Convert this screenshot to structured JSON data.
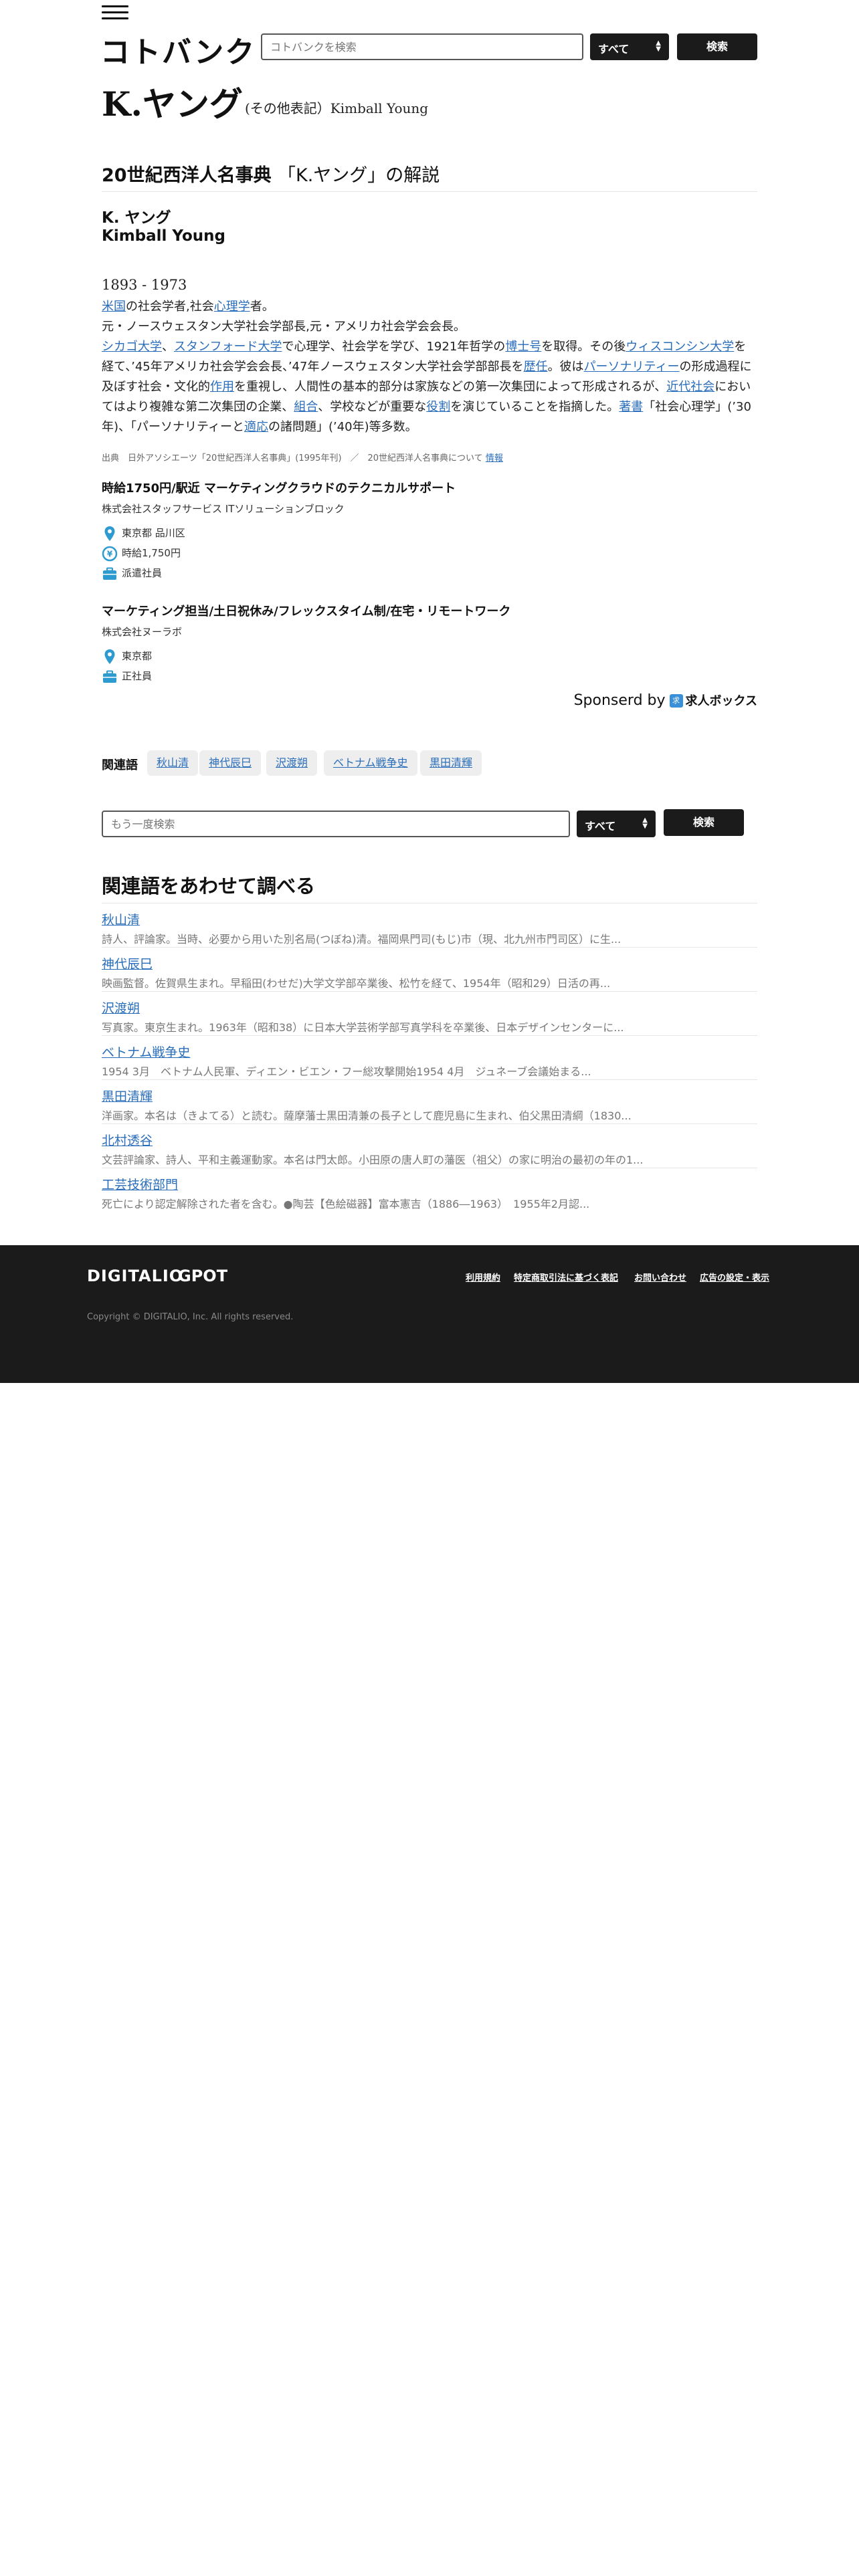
{
  "header": {
    "logo": "コトバンク",
    "search_placeholder": "コトバンクを検索",
    "select_value": "すべて",
    "search_button": "検索"
  },
  "page": {
    "title": "K.ヤング",
    "title_alt": "(その他表記）Kimball Young"
  },
  "dictionary": {
    "name": "20世紀西洋人名事典",
    "heading_suffix": "「K.ヤング」の解説",
    "entry_name_ja": "K. ヤング",
    "entry_name_en": "Kimball Young",
    "years": "1893 - 1973",
    "line1": {
      "a": "米国",
      "b": "の社会学者,社会",
      "c": "心理学",
      "d": "者。"
    },
    "line2": "元・ノースウェスタン大学社会学部長,元・アメリカ社会学会会長。",
    "para": {
      "p1": "シカゴ大学",
      "p2": "、",
      "p3": "スタンフォード大学",
      "p4": "で心理学、社会学を学び、1921年哲学の",
      "p5": "博士号",
      "p6": "を取得。その後",
      "p7": "ウィスコンシン大学",
      "p8": "を経て、’45年アメリカ社会学会会長、’47年ノースウェスタン大学社会学部部長を",
      "p9": "歴任",
      "p10": "。彼は",
      "p11": "パーソナリティー",
      "p12": "の形成過程に及ぼす社会・文化的",
      "p13": "作用",
      "p14": "を重視し、人間性の基本的部分は家族などの第一次集団によって形成されるが、",
      "p15": "近代社会",
      "p16": "においてはより複雑な第二次集団の企業、",
      "p17": "組合",
      "p18": "、学校などが重要な",
      "p19": "役割",
      "p20": "を演じていることを指摘した。",
      "p21": "著書",
      "p22": "「社会心理学」(’30年)、「パーソナリティーと",
      "p23": "適応",
      "p24": "の諸問題」(’40年)等多数。"
    },
    "source_text": "出典　日外アソシエーツ「20世紀西洋人名事典」(1995年刊)　／　20世紀西洋人名事典について",
    "source_link": "情報"
  },
  "jobs": [
    {
      "title": "時給1750円/駅近 マーケティングクラウドのテクニカルサポート",
      "company": "株式会社スタッフサービス ITソリューションブロック",
      "location": "東京都 品川区",
      "wage": "時給1,750円",
      "type": "派遣社員"
    },
    {
      "title": "マーケティング担当/土日祝休み/フレックスタイム制/在宅・リモートワーク",
      "company": "株式会社ヌーラボ",
      "location": "東京都",
      "type": "正社員"
    }
  ],
  "sponsor": {
    "label": "Sponserd by",
    "brand": "求人ボックス",
    "badge": "求人"
  },
  "related_tags": {
    "label": "関連語",
    "items": [
      "秋山清",
      "神代辰巳",
      "沢渡朔",
      "ベトナム戦争史",
      "黒田清輝"
    ]
  },
  "bottom_search": {
    "placeholder": "もう一度検索",
    "select_value": "すべて",
    "button": "検索"
  },
  "related_section": {
    "title": "関連語をあわせて調べる",
    "items": [
      {
        "title": "秋山清",
        "desc": "詩人、評論家。当時、必要から用いた別名局(つぼね)清。福岡県門司(もじ)市（現、北九州市門司区）に生..."
      },
      {
        "title": "神代辰巳",
        "desc": "映画監督。佐賀県生まれ。早稲田(わせだ)大学文学部卒業後、松竹を経て、1954年（昭和29）日活の再..."
      },
      {
        "title": "沢渡朔",
        "desc": "写真家。東京生まれ。1963年（昭和38）に日本大学芸術学部写真学科を卒業後、日本デザインセンターに..."
      },
      {
        "title": "ベトナム戦争史",
        "desc": "1954 3月　ベトナム人民軍、ディエン・ビエン・フー総攻撃開始1954 4月　ジュネーブ会議始まる..."
      },
      {
        "title": "黒田清輝",
        "desc": "洋画家。本名は（きよてる）と読む。薩摩藩士黒田清兼の長子として鹿児島に生まれ、伯父黒田清綱（1830..."
      },
      {
        "title": "北村透谷",
        "desc": "文芸評論家、詩人、平和主義運動家。本名は門太郎。小田原の唐人町の藩医（祖父）の家に明治の最初の年の1..."
      },
      {
        "title": "工芸技術部門",
        "desc": "死亡により認定解除された者を含む。●陶芸【色絵磁器】富本憲吉（1886―1963）　1955年2月認..."
      }
    ]
  },
  "footer": {
    "logo1": "DIGITALIO",
    "logo2": "GPOT",
    "links": [
      "利用規約",
      "特定商取引法に基づく表記",
      "お問い合わせ",
      "広告の設定・表示"
    ],
    "copyright": "Copyright © DIGITALIO, Inc. All rights reserved."
  }
}
